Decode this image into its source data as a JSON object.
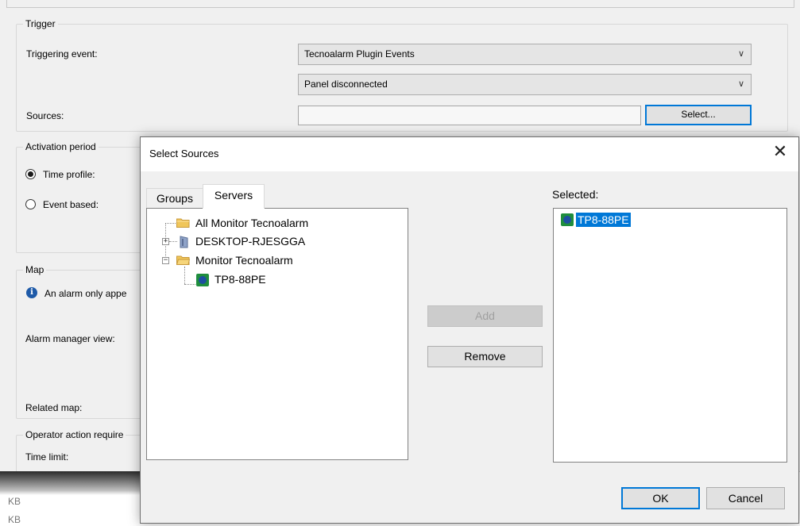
{
  "trigger": {
    "title": "Trigger",
    "triggering_event_label": "Triggering event:",
    "event_category": "Tecnoalarm Plugin Events",
    "event_type": "Panel disconnected",
    "sources_label": "Sources:",
    "sources_value": "",
    "select_button": "Select..."
  },
  "activation": {
    "title": "Activation period",
    "time_profile": "Time profile:",
    "event_based": "Event based:",
    "selected_option": "Time profile"
  },
  "map": {
    "title": "Map",
    "info_text": "An alarm only appe",
    "alarm_manager_view": "Alarm manager view:",
    "related_map": "Related map:"
  },
  "operator": {
    "title": "Operator action require",
    "time_limit": "Time limit:"
  },
  "below": [
    "KB",
    "KB"
  ],
  "dialog": {
    "title": "Select Sources",
    "close_glyph": "✕",
    "tabs": [
      {
        "label": "Groups"
      },
      {
        "label": "Servers"
      }
    ],
    "active_tab": "Servers",
    "tree": [
      {
        "label": "All Monitor Tecnoalarm",
        "icon": "folder-icon"
      },
      {
        "label": "DESKTOP-RJESGGA",
        "icon": "server-icon",
        "expander": "+"
      },
      {
        "label": "Monitor Tecnoalarm",
        "icon": "folder-icon",
        "expander": "−"
      },
      {
        "label": "TP8-88PE",
        "icon": "device-icon"
      }
    ],
    "add_button": "Add",
    "remove_button": "Remove",
    "selected_label": "Selected:",
    "selected_items": [
      {
        "label": "TP8-88PE",
        "icon": "device-icon"
      }
    ],
    "ok_button": "OK",
    "cancel_button": "Cancel"
  }
}
